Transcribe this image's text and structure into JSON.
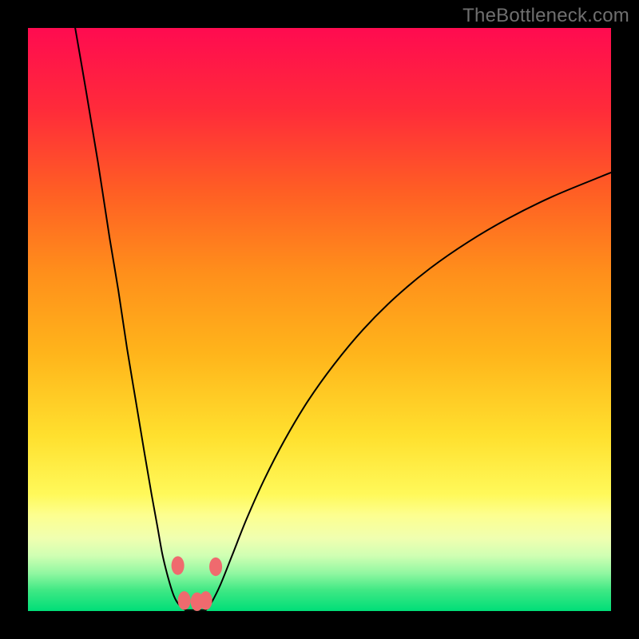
{
  "watermark": "TheBottleneck.com",
  "chart_data": {
    "type": "line",
    "title": "",
    "xlabel": "",
    "ylabel": "",
    "xlim": [
      0,
      100
    ],
    "ylim": [
      0,
      100
    ],
    "grid": false,
    "background_gradient": {
      "stops": [
        {
          "pos": 0.0,
          "color": "#ff0b50"
        },
        {
          "pos": 0.14,
          "color": "#ff2b3a"
        },
        {
          "pos": 0.28,
          "color": "#ff5e24"
        },
        {
          "pos": 0.42,
          "color": "#ff8f1b"
        },
        {
          "pos": 0.56,
          "color": "#ffb51b"
        },
        {
          "pos": 0.7,
          "color": "#ffe02e"
        },
        {
          "pos": 0.8,
          "color": "#fff95a"
        },
        {
          "pos": 0.835,
          "color": "#fdff8f"
        },
        {
          "pos": 0.875,
          "color": "#f0ffb0"
        },
        {
          "pos": 0.905,
          "color": "#d0ffb3"
        },
        {
          "pos": 0.935,
          "color": "#91f7a1"
        },
        {
          "pos": 0.965,
          "color": "#3ee884"
        },
        {
          "pos": 1.0,
          "color": "#00de78"
        }
      ]
    },
    "series": [
      {
        "name": "left-branch",
        "stroke": "#000000",
        "x": [
          8.1,
          10,
          12,
          14,
          15.5,
          17,
          18.5,
          20,
          21.2,
          22.2,
          23,
          23.7,
          24.3,
          24.8,
          25.2,
          25.6,
          26.0,
          26.4,
          26.8,
          27.0
        ],
        "y": [
          100,
          89,
          77,
          64,
          55,
          45,
          36,
          27,
          20,
          14.5,
          10,
          7,
          4.8,
          3.2,
          2.2,
          1.5,
          1.0,
          0.6,
          0.3,
          0.15
        ]
      },
      {
        "name": "right-branch",
        "stroke": "#000000",
        "x": [
          30.5,
          31.5,
          33.0,
          35.0,
          37.5,
          40.5,
          44.0,
          48.0,
          52.5,
          57.5,
          63.0,
          69.0,
          75.5,
          82.5,
          90.0,
          98.0,
          100.0
        ],
        "y": [
          0.15,
          1.5,
          4.5,
          9.5,
          15.8,
          22.5,
          29.3,
          36.0,
          42.3,
          48.3,
          53.8,
          58.8,
          63.3,
          67.4,
          71.1,
          74.4,
          75.2
        ]
      }
    ],
    "flat_bottom": {
      "from_x": 27.0,
      "to_x": 30.5,
      "y": 0.15
    },
    "markers": {
      "color": "#ef6a6e",
      "rx": 1.1,
      "ry": 1.6,
      "points": [
        {
          "x": 25.7,
          "y": 7.8
        },
        {
          "x": 26.8,
          "y": 1.8
        },
        {
          "x": 29.0,
          "y": 1.6
        },
        {
          "x": 30.5,
          "y": 1.8
        },
        {
          "x": 32.2,
          "y": 7.6
        }
      ]
    }
  }
}
